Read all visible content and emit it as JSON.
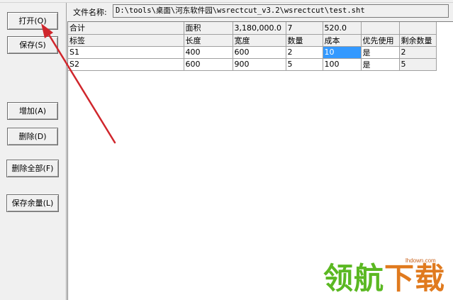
{
  "left_panel": {
    "open_button": "打开(O)",
    "save_button": "保存(S)",
    "add_button": "增加(A)",
    "delete_button": "删除(D)",
    "delete_all_button": "删除全部(F)",
    "save_remainder_button": "保存余量(L)"
  },
  "file": {
    "label": "文件名称:",
    "path": "D:\\tools\\桌面\\河东软件园\\wsrectcut_v3.2\\wsrectcut\\test.sht"
  },
  "grid": {
    "summary_row": [
      "合计",
      "面积",
      "3,180,000.0",
      "7",
      "520.0",
      "",
      ""
    ],
    "header_row": [
      "标签",
      "长度",
      "宽度",
      "数量",
      "成本",
      "优先使用",
      "剩余数量"
    ],
    "rows": [
      [
        "S1",
        "400",
        "600",
        "2",
        "10",
        "是",
        "2"
      ],
      [
        "S2",
        "600",
        "900",
        "5",
        "100",
        "是",
        "5"
      ]
    ]
  },
  "watermark": {
    "site": "lhdown.com",
    "text_main": "领航",
    "text_accent": "下载"
  },
  "colors": {
    "selection": "#3399ff",
    "arrow": "#d0262c",
    "watermark_green": "#5bb822",
    "watermark_orange": "#e07a1e"
  }
}
